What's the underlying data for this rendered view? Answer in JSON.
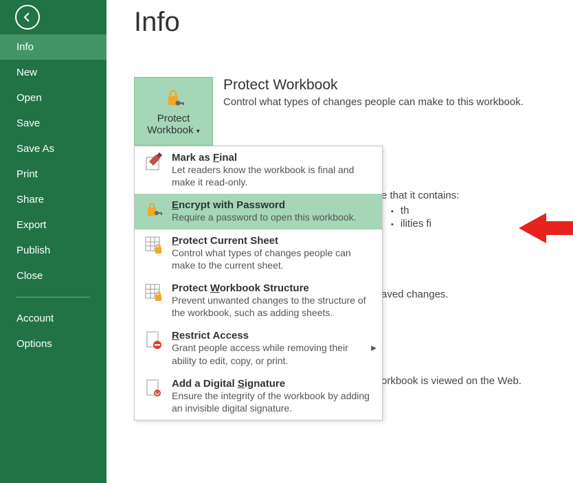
{
  "sidebar": {
    "items": [
      {
        "label": "Info"
      },
      {
        "label": "New"
      },
      {
        "label": "Open"
      },
      {
        "label": "Save"
      },
      {
        "label": "Save As"
      },
      {
        "label": "Print"
      },
      {
        "label": "Share"
      },
      {
        "label": "Export"
      },
      {
        "label": "Publish"
      },
      {
        "label": "Close"
      }
    ],
    "footer": [
      {
        "label": "Account"
      },
      {
        "label": "Options"
      }
    ]
  },
  "page_title": "Info",
  "protect_button": {
    "line1": "Protect",
    "line2": "Workbook"
  },
  "sections": {
    "protect": {
      "title": "Protect Workbook",
      "desc": "Control what types of changes people can make to this workbook."
    },
    "inspect": {
      "intro_suffix": "e that it contains:",
      "items": [
        "th",
        "ilities fi"
      ]
    },
    "manage": {
      "row_suffix": "aved changes."
    },
    "browser": {
      "desc_suffix": "orkbook is viewed on the Web."
    }
  },
  "dropdown": [
    {
      "title_pre": "Mark as ",
      "title_ul": "F",
      "title_post": "inal",
      "desc": "Let readers know the workbook is final and make it read-only."
    },
    {
      "title_pre": "",
      "title_ul": "E",
      "title_post": "ncrypt with Password",
      "desc": "Require a password to open this workbook."
    },
    {
      "title_pre": "",
      "title_ul": "P",
      "title_post": "rotect Current Sheet",
      "desc": "Control what types of changes people can make to the current sheet."
    },
    {
      "title_pre": "Protect ",
      "title_ul": "W",
      "title_post": "orkbook Structure",
      "desc": "Prevent unwanted changes to the structure of the workbook, such as adding sheets."
    },
    {
      "title_pre": "",
      "title_ul": "R",
      "title_post": "estrict Access",
      "desc": "Grant people access while removing their ability to edit, copy, or print."
    },
    {
      "title_pre": "Add a Digital ",
      "title_ul": "S",
      "title_post": "ignature",
      "desc": "Ensure the integrity of the workbook by adding an invisible digital signature."
    }
  ]
}
